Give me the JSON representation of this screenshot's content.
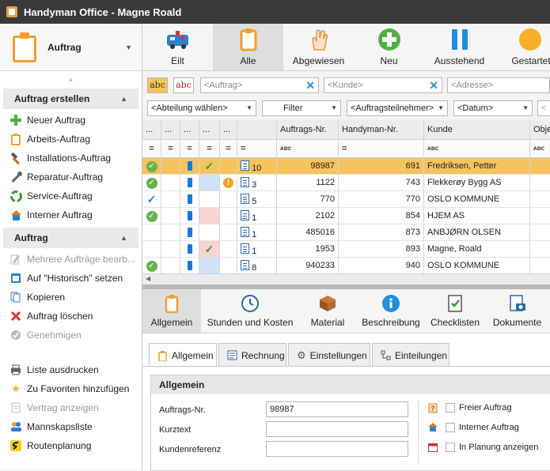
{
  "window": {
    "title": "Handyman Office - Magne Roald"
  },
  "module": {
    "label": "Auftrag"
  },
  "sections": [
    {
      "title": "Auftrag erstellen",
      "items": [
        {
          "label": "Neuer Auftrag",
          "icon": "plus-icon"
        },
        {
          "label": "Arbeits-Auftrag",
          "icon": "clipboard-icon"
        },
        {
          "label": "Installations-Auftrag",
          "icon": "hammer-icon"
        },
        {
          "label": "Reparatur-Auftrag",
          "icon": "wrench-icon"
        },
        {
          "label": "Service-Auftrag",
          "icon": "recycle-icon"
        },
        {
          "label": "Interner Auftrag",
          "icon": "house-icon"
        }
      ]
    },
    {
      "title": "Auftrag",
      "items": [
        {
          "label": "Mehrere Aufträge bearb...",
          "icon": "edit-icon",
          "disabled": true
        },
        {
          "label": "Auf \"Historisch\" setzen",
          "icon": "history-icon"
        },
        {
          "label": "Kopieren",
          "icon": "copy-icon"
        },
        {
          "label": "Auftrag löschen",
          "icon": "delete-icon"
        },
        {
          "label": "Genehmigen",
          "icon": "approve-icon",
          "disabled": true
        }
      ]
    }
  ],
  "extra_items": [
    {
      "label": "Liste ausdrucken",
      "icon": "print-icon"
    },
    {
      "label": "Zu Favoriten hinzufügen",
      "icon": "star-icon"
    },
    {
      "label": "Vertrag anzeigen",
      "icon": "contract-icon",
      "disabled": true
    },
    {
      "label": "Mannskapsliste",
      "icon": "people-icon"
    },
    {
      "label": "Routenplanung",
      "icon": "route-icon"
    }
  ],
  "toolbar": {
    "buttons": [
      {
        "label": "Eilt"
      },
      {
        "label": "Alle"
      },
      {
        "label": "Abgewiesen"
      },
      {
        "label": "Neu"
      },
      {
        "label": "Ausstehend"
      },
      {
        "label": "Gestartet"
      }
    ]
  },
  "filters": {
    "abc": "abc",
    "auftrag_placeholder": "<Auftrag>",
    "kunde_placeholder": "<Kunde>",
    "adresse_placeholder": "<Adresse>",
    "abteilung": "<Abteilung wählen>",
    "filter": "Filter",
    "teilnehmer": "<Auftragsteilnehmer>",
    "datum": "<Datum>"
  },
  "grid": {
    "dots": "...",
    "eq": "=",
    "abc_filter": "ᴀʙᴄ",
    "columns": {
      "auftrags_nr": "Auftrags-Nr.",
      "handyman_nr": "Handyman-Nr.",
      "kunde": "Kunde",
      "obj": "Obje"
    },
    "rows": [
      {
        "count": "10",
        "auftrags_nr": "98987",
        "handyman_nr": "691",
        "kunde": "Fredriksen, Petter"
      },
      {
        "count": "3",
        "auftrags_nr": "1122",
        "handyman_nr": "743",
        "kunde": "Flekkerøy Bygg AS"
      },
      {
        "count": "5",
        "auftrags_nr": "770",
        "handyman_nr": "770",
        "kunde": "OSLO KOMMUNE"
      },
      {
        "count": "1",
        "auftrags_nr": "2102",
        "handyman_nr": "854",
        "kunde": "HJEM AS"
      },
      {
        "count": "1",
        "auftrags_nr": "485016",
        "handyman_nr": "873",
        "kunde": "ANBJØRN OLSEN"
      },
      {
        "count": "1",
        "auftrags_nr": "1953",
        "handyman_nr": "893",
        "kunde": "Magne, Roald"
      },
      {
        "count": "8",
        "auftrags_nr": "940233",
        "handyman_nr": "940",
        "kunde": "OSLO KOMMUNE"
      }
    ]
  },
  "detail_tabs": [
    {
      "label": "Allgemein"
    },
    {
      "label": "Stunden und Kosten"
    },
    {
      "label": "Material"
    },
    {
      "label": "Beschreibung"
    },
    {
      "label": "Checklisten"
    },
    {
      "label": "Dokumente"
    }
  ],
  "sub_tabs": [
    {
      "label": "Allgemein"
    },
    {
      "label": "Rechnung"
    },
    {
      "label": "Einstellungen"
    },
    {
      "label": "Einteilungen"
    }
  ],
  "form": {
    "header": "Allgemein",
    "auftrags_nr_label": "Auftrags-Nr.",
    "auftrags_nr_value": "98987",
    "kurztext_label": "Kurztext",
    "kurztext_value": "",
    "kundenreferenz_label": "Kundenreferenz",
    "kundenreferenz_value": "",
    "freier_auftrag": "Freier Auftrag",
    "interner_auftrag": "Interner Auftrag",
    "in_planung": "In Planung anzeigen"
  }
}
